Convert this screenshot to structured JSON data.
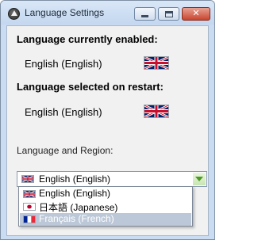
{
  "window": {
    "title": "Language Settings",
    "icon": "unity-logo-icon",
    "controls": [
      "minimize-icon",
      "maximize-icon",
      "close-icon"
    ],
    "close_glyph": "✕"
  },
  "current": {
    "heading": "Language currently enabled:",
    "value": "English (English)",
    "flag": "uk-flag-icon"
  },
  "restart": {
    "heading": "Language selected on restart:",
    "value": "English (English)",
    "flag": "uk-flag-icon"
  },
  "region": {
    "label": "Language and Region:",
    "selected_value": "English (English)",
    "options": [
      {
        "label": "English (English)",
        "flag": "uk-flag-icon"
      },
      {
        "label": "日本語 (Japanese)",
        "flag": "japan-flag-icon"
      },
      {
        "label": "Français (French)",
        "flag": "france-flag-icon",
        "highlighted": true
      }
    ]
  },
  "colors": {
    "titlebar": "#c9dcf2",
    "client_bg": "#f1f1f1",
    "dropdown_arrow": "#4d9a22",
    "highlight": "#bcc8d7",
    "close_button": "#c9452f"
  }
}
